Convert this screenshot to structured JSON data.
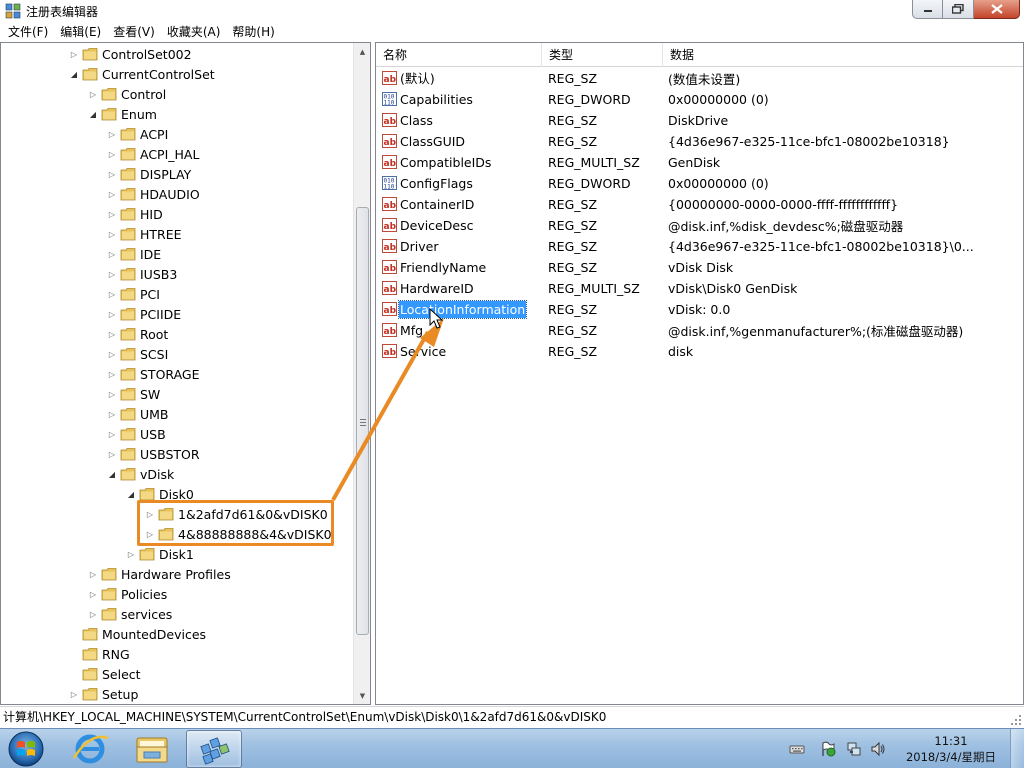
{
  "window": {
    "title": "注册表编辑器",
    "min_label": "",
    "max_label": "",
    "close_label": ""
  },
  "menu": [
    "文件(F)",
    "编辑(E)",
    "查看(V)",
    "收藏夹(A)",
    "帮助(H)"
  ],
  "tree": [
    {
      "label": "ControlSet002",
      "expander": "collapsed"
    },
    {
      "label": "CurrentControlSet",
      "expander": "expanded"
    },
    {
      "label": "Control",
      "expander": "collapsed"
    },
    {
      "label": "Enum",
      "expander": "expanded"
    },
    {
      "label": "ACPI",
      "expander": "collapsed"
    },
    {
      "label": "ACPI_HAL",
      "expander": "collapsed"
    },
    {
      "label": "DISPLAY",
      "expander": "collapsed"
    },
    {
      "label": "HDAUDIO",
      "expander": "collapsed"
    },
    {
      "label": "HID",
      "expander": "collapsed"
    },
    {
      "label": "HTREE",
      "expander": "collapsed"
    },
    {
      "label": "IDE",
      "expander": "collapsed"
    },
    {
      "label": "IUSB3",
      "expander": "collapsed"
    },
    {
      "label": "PCI",
      "expander": "collapsed"
    },
    {
      "label": "PCIIDE",
      "expander": "collapsed"
    },
    {
      "label": "Root",
      "expander": "collapsed"
    },
    {
      "label": "SCSI",
      "expander": "collapsed"
    },
    {
      "label": "STORAGE",
      "expander": "collapsed"
    },
    {
      "label": "SW",
      "expander": "collapsed"
    },
    {
      "label": "UMB",
      "expander": "collapsed"
    },
    {
      "label": "USB",
      "expander": "collapsed"
    },
    {
      "label": "USBSTOR",
      "expander": "collapsed"
    },
    {
      "label": "vDisk",
      "expander": "expanded"
    },
    {
      "label": "Disk0",
      "expander": "expanded"
    },
    {
      "label": "1&2afd7d61&0&vDISK0",
      "expander": "collapsed"
    },
    {
      "label": "4&88888888&4&vDISK0",
      "expander": "collapsed"
    },
    {
      "label": "Disk1",
      "expander": "collapsed"
    },
    {
      "label": "Hardware Profiles",
      "expander": "collapsed"
    },
    {
      "label": "Policies",
      "expander": "collapsed"
    },
    {
      "label": "services",
      "expander": "collapsed"
    },
    {
      "label": "MountedDevices",
      "expander": "none"
    },
    {
      "label": "RNG",
      "expander": "none"
    },
    {
      "label": "Select",
      "expander": "none"
    },
    {
      "label": "Setup",
      "expander": "collapsed"
    }
  ],
  "list": {
    "headers": {
      "name": "名称",
      "type": "类型",
      "data": "数据"
    },
    "rows": [
      {
        "name": "(默认)",
        "type": "REG_SZ",
        "data": "(数值未设置)",
        "icon": "string-value-icon"
      },
      {
        "name": "Capabilities",
        "type": "REG_DWORD",
        "data": "0x00000000 (0)",
        "icon": "binary-value-icon"
      },
      {
        "name": "Class",
        "type": "REG_SZ",
        "data": "DiskDrive",
        "icon": "string-value-icon"
      },
      {
        "name": "ClassGUID",
        "type": "REG_SZ",
        "data": "{4d36e967-e325-11ce-bfc1-08002be10318}",
        "icon": "string-value-icon"
      },
      {
        "name": "CompatibleIDs",
        "type": "REG_MULTI_SZ",
        "data": "GenDisk",
        "icon": "string-value-icon"
      },
      {
        "name": "ConfigFlags",
        "type": "REG_DWORD",
        "data": "0x00000000 (0)",
        "icon": "binary-value-icon"
      },
      {
        "name": "ContainerID",
        "type": "REG_SZ",
        "data": "{00000000-0000-0000-ffff-ffffffffffff}",
        "icon": "string-value-icon"
      },
      {
        "name": "DeviceDesc",
        "type": "REG_SZ",
        "data": "@disk.inf,%disk_devdesc%;磁盘驱动器",
        "icon": "string-value-icon"
      },
      {
        "name": "Driver",
        "type": "REG_SZ",
        "data": "{4d36e967-e325-11ce-bfc1-08002be10318}\\0...",
        "icon": "string-value-icon"
      },
      {
        "name": "FriendlyName",
        "type": "REG_SZ",
        "data": "vDisk Disk",
        "icon": "string-value-icon"
      },
      {
        "name": "HardwareID",
        "type": "REG_MULTI_SZ",
        "data": "vDisk\\Disk0 GenDisk",
        "icon": "string-value-icon"
      },
      {
        "name": "LocationInformation",
        "type": "REG_SZ",
        "data": "vDisk: 0.0",
        "icon": "string-value-icon",
        "selected": true
      },
      {
        "name": "Mfg",
        "type": "REG_SZ",
        "data": "@disk.inf,%genmanufacturer%;(标准磁盘驱动器)",
        "icon": "string-value-icon"
      },
      {
        "name": "Service",
        "type": "REG_SZ",
        "data": "disk",
        "icon": "string-value-icon"
      }
    ]
  },
  "status": {
    "path": "计算机\\HKEY_LOCAL_MACHINE\\SYSTEM\\CurrentControlSet\\Enum\\vDisk\\Disk0\\1&2afd7d61&0&vDISK0"
  },
  "taskbar": {
    "apps": [
      "internet-explorer-icon",
      "file-explorer-icon",
      "registry-editor-icon"
    ],
    "time": "11:31",
    "date": "2018/3/4/星期日"
  },
  "colors": {
    "selection": "#3399ff",
    "annotation": "#e98a25",
    "folder": "#e8c35a"
  }
}
